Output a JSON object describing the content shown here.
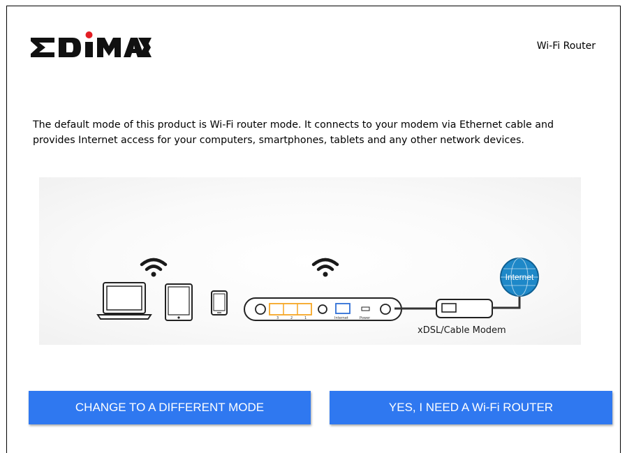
{
  "brand": {
    "name": "EDIMAX",
    "accent_color": "#e31e24"
  },
  "header": {
    "product_name": "Wi-Fi Router"
  },
  "content": {
    "description": "The default mode of this product is Wi-Fi router mode. It connects to your modem via Ethernet cable and provides Internet access for your computers, smartphones, tablets and any other network devices."
  },
  "diagram": {
    "devices": [
      "laptop-icon",
      "tablet-icon",
      "smartphone-icon",
      "router-icon",
      "modem-icon",
      "globe-icon"
    ],
    "router_port_labels": [
      "3",
      "2",
      "1",
      "Internet",
      "Power"
    ],
    "internet_label": "Internet",
    "modem_label": "xDSL/Cable Modem",
    "colors": {
      "lan_ports": "#f5a623",
      "wan_port": "#2f6fd6",
      "globe": "#1e88c8"
    }
  },
  "buttons": {
    "change_mode": "CHANGE TO A DIFFERENT MODE",
    "yes_router": "YES, I NEED A Wi-Fi ROUTER",
    "color": "#2f78f0"
  }
}
